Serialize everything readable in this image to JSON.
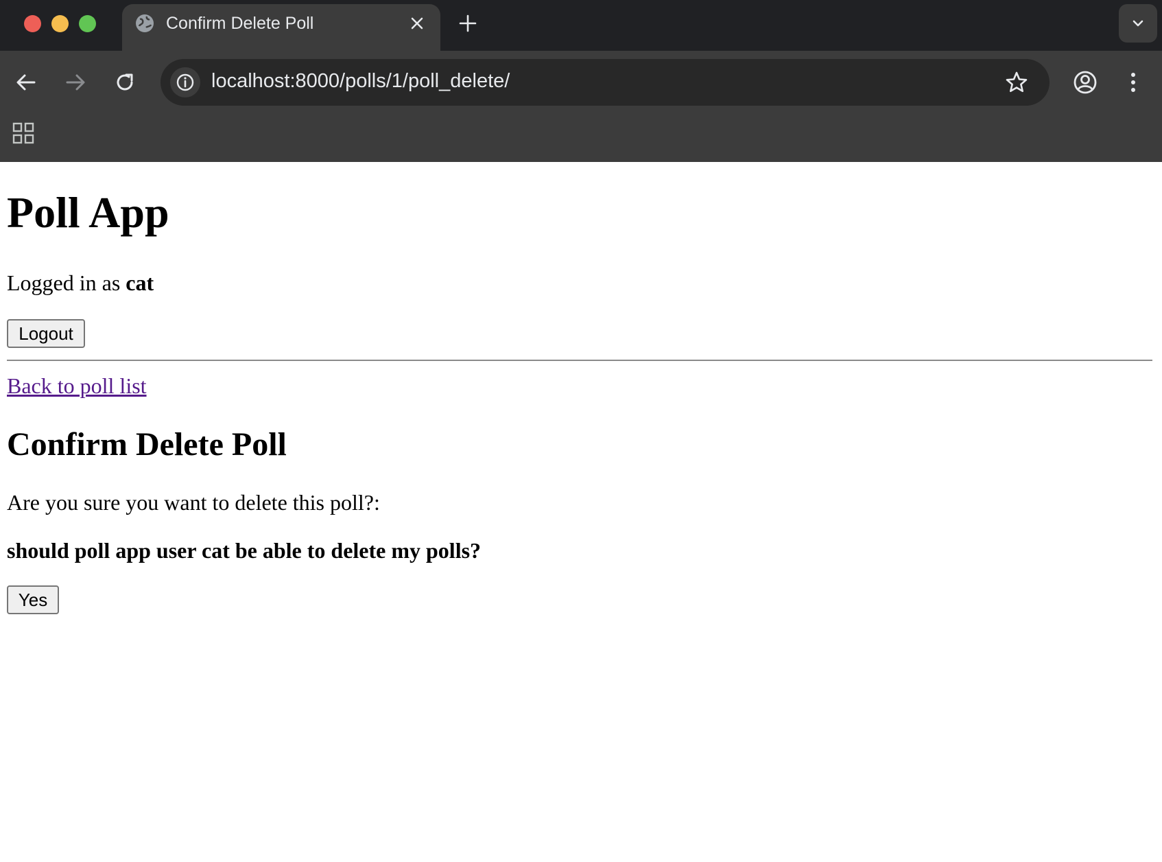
{
  "browser": {
    "tab": {
      "title": "Confirm Delete Poll"
    },
    "address_bar": {
      "url": "localhost:8000/polls/1/poll_delete/"
    }
  },
  "page": {
    "app_title": "Poll App",
    "logged_in_prefix": "Logged in as",
    "username": "cat",
    "logout_label": "Logout",
    "back_link_label": "Back to poll list",
    "heading": "Confirm Delete Poll",
    "question": "Are you sure you want to delete this poll?:",
    "poll_title": "should poll app user cat be able to delete my polls?",
    "confirm_label": "Yes"
  },
  "colors": {
    "chrome_dark": "#202124",
    "chrome_toolbar": "#3c3c3c",
    "omnibox": "#282828",
    "visited_link": "#551a8b"
  }
}
